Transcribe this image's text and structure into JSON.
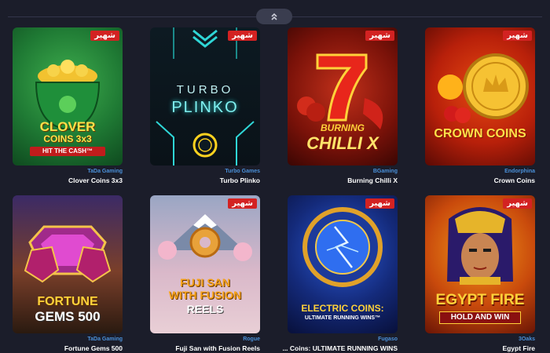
{
  "badge_label": "شهير",
  "games": [
    {
      "thumb_lines": [
        "CLOVER",
        "COINS 3x3",
        "HIT THE CASH™"
      ],
      "provider": "TaDa Gaming",
      "name": "Clover Coins 3x3"
    },
    {
      "thumb_lines": [
        "TURBO",
        "PLINKO"
      ],
      "provider": "Turbo Games",
      "name": "Turbo Plinko"
    },
    {
      "thumb_lines": [
        "BURNING",
        "CHILLI X"
      ],
      "provider": "BGaming",
      "name": "Burning Chilli X"
    },
    {
      "thumb_lines": [
        "CROWN COINS"
      ],
      "provider": "Endorphina",
      "name": "Crown Coins"
    },
    {
      "thumb_lines": [
        "FORTUNE",
        "GEMS 500"
      ],
      "provider": "TaDa Gaming",
      "name": "Fortune Gems 500"
    },
    {
      "thumb_lines": [
        "FUJI SAN",
        "WITH FUSION",
        "REELS"
      ],
      "provider": "Rogue",
      "name": "Fuji San with Fusion Reels"
    },
    {
      "thumb_lines": [
        "ELECTRIC COINS:",
        "ULTIMATE RUNNING WINS™"
      ],
      "provider": "Fugaso",
      "name": "... Coins: ULTIMATE RUNNING WINS"
    },
    {
      "thumb_lines": [
        "EGYPT FIRE",
        "HOLD AND WIN"
      ],
      "provider": "3Oaks",
      "name": "Egypt Fire"
    }
  ],
  "icons": {
    "collapse": "double-chevron-up-icon"
  }
}
